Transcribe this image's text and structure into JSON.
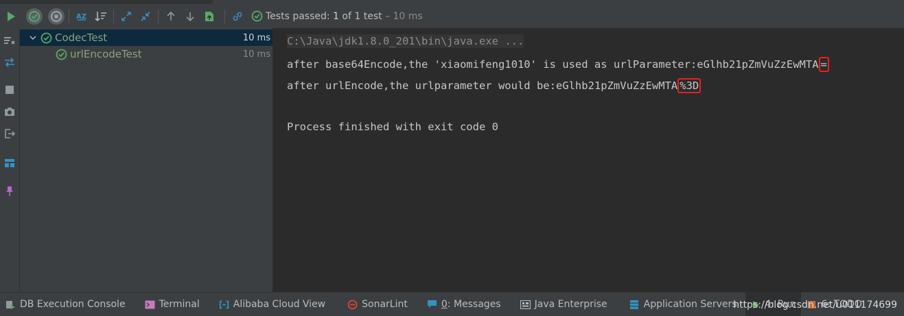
{
  "status": {
    "prefix": "Tests passed: ",
    "count": "1",
    "middle": " of 1 test",
    "duration": " – 10 ms"
  },
  "tree": {
    "items": [
      {
        "label": "CodecTest",
        "time": "10 ms"
      },
      {
        "label": "urlEncodeTest",
        "time": "10 ms"
      }
    ]
  },
  "console": {
    "cmd": "C:\\Java\\jdk1.8.0_201\\bin\\java.exe ...",
    "line1_prefix": "after base64Encode,the 'xiaomifeng1010' is used as urlParameter:eGlhb21pZmVuZzEwMTA",
    "line1_mark": "=",
    "line2_prefix": "after urlEncode,the urlparameter would be:eGlhb21pZmVuZzEwMTA",
    "line2_mark": "%3D",
    "finish": "Process finished with exit code 0"
  },
  "bottombar": {
    "db_console": "DB Execution Console",
    "terminal": "Terminal",
    "alibaba": "Alibaba Cloud View",
    "sonarlint": "SonarLint",
    "messages_num": "0",
    "messages_rest": ": Messages",
    "java_enterprise": "Java Enterprise",
    "app_servers": "Application Servers",
    "run": "4: Run",
    "todo": "6: TODO",
    "watermark": "https://blog.csdn.net/u011174699"
  },
  "colors": {
    "accent_green": "#59a869",
    "highlight_red": "#e82020",
    "selection": "#0d293e"
  }
}
